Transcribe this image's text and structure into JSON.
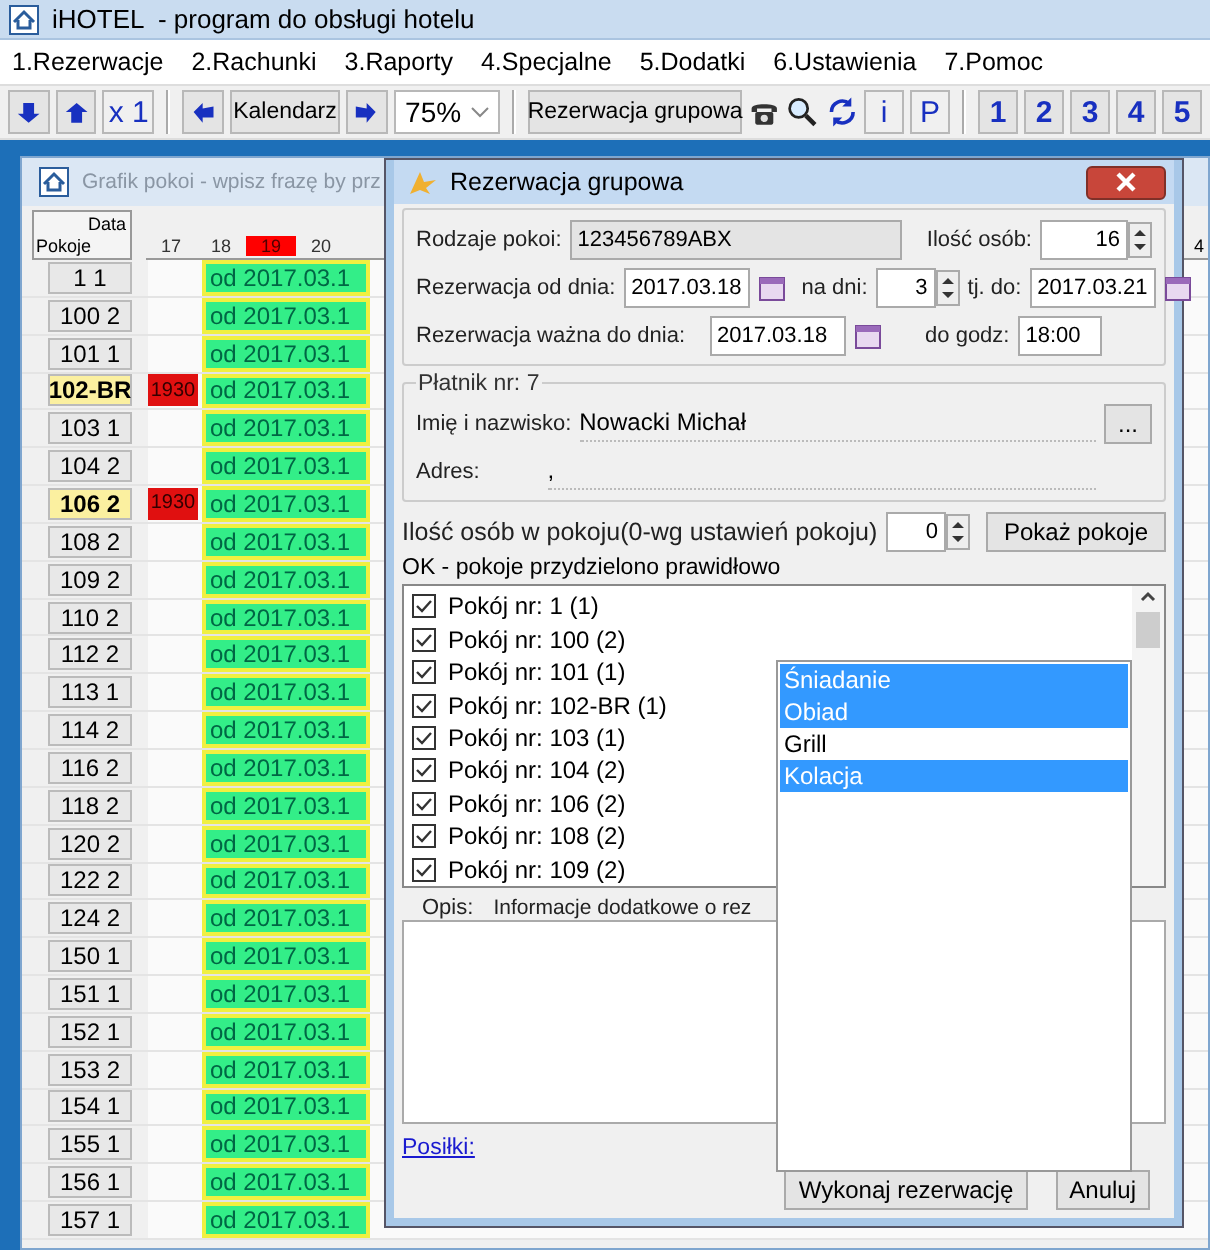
{
  "window": {
    "title": "iHOTEL  - program do obsługi hotelu"
  },
  "menu": [
    "1.Rezerwacje",
    "2.Rachunki",
    "3.Raporty",
    "4.Specjalne",
    "5.Dodatki",
    "6.Ustawienia",
    "7.Pomoc"
  ],
  "toolbar": {
    "multiplier": "x 1",
    "calendar": "Kalendarz",
    "zoom": "75%",
    "group_button": "Rezerwacja grupowa",
    "info": "i",
    "parking": "P",
    "numbers": [
      "1",
      "2",
      "3",
      "4",
      "5"
    ]
  },
  "schedule": {
    "title": "Grafik pokoi - wpisz frazę by prz",
    "corner_top": "Data",
    "corner_bottom": "Pokoje",
    "far_day": "4",
    "days": [
      {
        "label": "17",
        "selected": false
      },
      {
        "label": "18",
        "selected": false
      },
      {
        "label": "19",
        "selected": true
      },
      {
        "label": "20",
        "selected": false
      }
    ],
    "rooms": [
      {
        "label": "1 1",
        "highlighted": false,
        "booking": "od 2017.03.1"
      },
      {
        "label": "100 2",
        "highlighted": false,
        "booking": "od 2017.03.1"
      },
      {
        "label": "101 1",
        "highlighted": false,
        "booking": "od 2017.03.1"
      },
      {
        "label": "102-BR",
        "highlighted": true,
        "marker": "1930",
        "booking": "od 2017.03.1"
      },
      {
        "label": "103 1",
        "highlighted": false,
        "booking": "od 2017.03.1"
      },
      {
        "label": "104 2",
        "highlighted": false,
        "booking": "od 2017.03.1"
      },
      {
        "label": "106 2",
        "highlighted": true,
        "marker": "1930",
        "booking": "od 2017.03.1"
      },
      {
        "label": "108 2",
        "highlighted": false,
        "booking": "od 2017.03.1"
      },
      {
        "label": "109 2",
        "highlighted": false,
        "booking": "od 2017.03.1"
      },
      {
        "label": "110 2",
        "highlighted": false,
        "booking": "od 2017.03.1"
      },
      {
        "label": "112 2",
        "highlighted": false,
        "booking": "od 2017.03.1"
      },
      {
        "label": "113 1",
        "highlighted": false,
        "booking": "od 2017.03.1"
      },
      {
        "label": "114 2",
        "highlighted": false,
        "booking": "od 2017.03.1"
      },
      {
        "label": "116 2",
        "highlighted": false,
        "booking": "od 2017.03.1"
      },
      {
        "label": "118 2",
        "highlighted": false,
        "booking": "od 2017.03.1"
      },
      {
        "label": "120 2",
        "highlighted": false,
        "booking": "od 2017.03.1"
      },
      {
        "label": "122 2",
        "highlighted": false,
        "booking": "od 2017.03.1"
      },
      {
        "label": "124 2",
        "highlighted": false,
        "booking": "od 2017.03.1"
      },
      {
        "label": "150 1",
        "highlighted": false,
        "booking": "od 2017.03.1"
      },
      {
        "label": "151 1",
        "highlighted": false,
        "booking": "od 2017.03.1"
      },
      {
        "label": "152 1",
        "highlighted": false,
        "booking": "od 2017.03.1"
      },
      {
        "label": "153 2",
        "highlighted": false,
        "booking": "od 2017.03.1"
      },
      {
        "label": "154 1",
        "highlighted": false,
        "booking": "od 2017.03.1"
      },
      {
        "label": "155 1",
        "highlighted": false,
        "booking": "od 2017.03.1"
      },
      {
        "label": "156 1",
        "highlighted": false,
        "booking": "od 2017.03.1"
      },
      {
        "label": "157 1",
        "highlighted": false,
        "booking": "od 2017.03.1"
      }
    ]
  },
  "dialog": {
    "title": "Rezerwacja grupowa",
    "room_types_label": "Rodzaje pokoi:",
    "room_types": "123456789ABX",
    "persons_label": "Ilość osób:",
    "persons": "16",
    "from_label": "Rezerwacja od dnia:",
    "from": "2017.03.18",
    "days_label": "na dni:",
    "days": "3",
    "to_label": "tj. do:",
    "to": "2017.03.21",
    "valid_label": "Rezerwacja ważna do dnia:",
    "valid": "2017.03.18",
    "hour_label": "do godz:",
    "hour": "18:00",
    "payer": {
      "legend": "Płatnik nr: 7",
      "name_label": "Imię i nazwisko:",
      "name": "Nowacki Michał",
      "more": "...",
      "address_label": "Adres:",
      "address": ","
    },
    "per_room_label": "Ilość osób w pokoju(0-wg ustawień pokoju)",
    "per_room": "0",
    "show_rooms": "Pokaż pokoje",
    "status": "OK - pokoje przydzielono prawidłowo",
    "rooms": [
      {
        "label": "Pokój nr: 1  (1)",
        "checked": true
      },
      {
        "label": "Pokój nr: 100  (2)",
        "checked": true
      },
      {
        "label": "Pokój nr: 101  (1)",
        "checked": true
      },
      {
        "label": "Pokój nr: 102-BR  (1)",
        "checked": true
      },
      {
        "label": "Pokój nr: 103  (1)",
        "checked": true
      },
      {
        "label": "Pokój nr: 104  (2)",
        "checked": true
      },
      {
        "label": "Pokój nr: 106  (2)",
        "checked": true
      },
      {
        "label": "Pokój nr: 108  (2)",
        "checked": true
      },
      {
        "label": "Pokój nr: 109  (2)",
        "checked": true
      }
    ],
    "description_label": "Opis:",
    "description_hint": "Informacje dodatkowe o rez",
    "meals_link": "Posiłki:",
    "buttons": [
      "Wykonaj rezerwację",
      "Anuluj"
    ]
  },
  "meals": [
    {
      "label": "Śniadanie",
      "selected": true
    },
    {
      "label": "Obiad",
      "selected": true
    },
    {
      "label": "Grill",
      "selected": false
    },
    {
      "label": "Kolacja",
      "selected": true
    }
  ]
}
